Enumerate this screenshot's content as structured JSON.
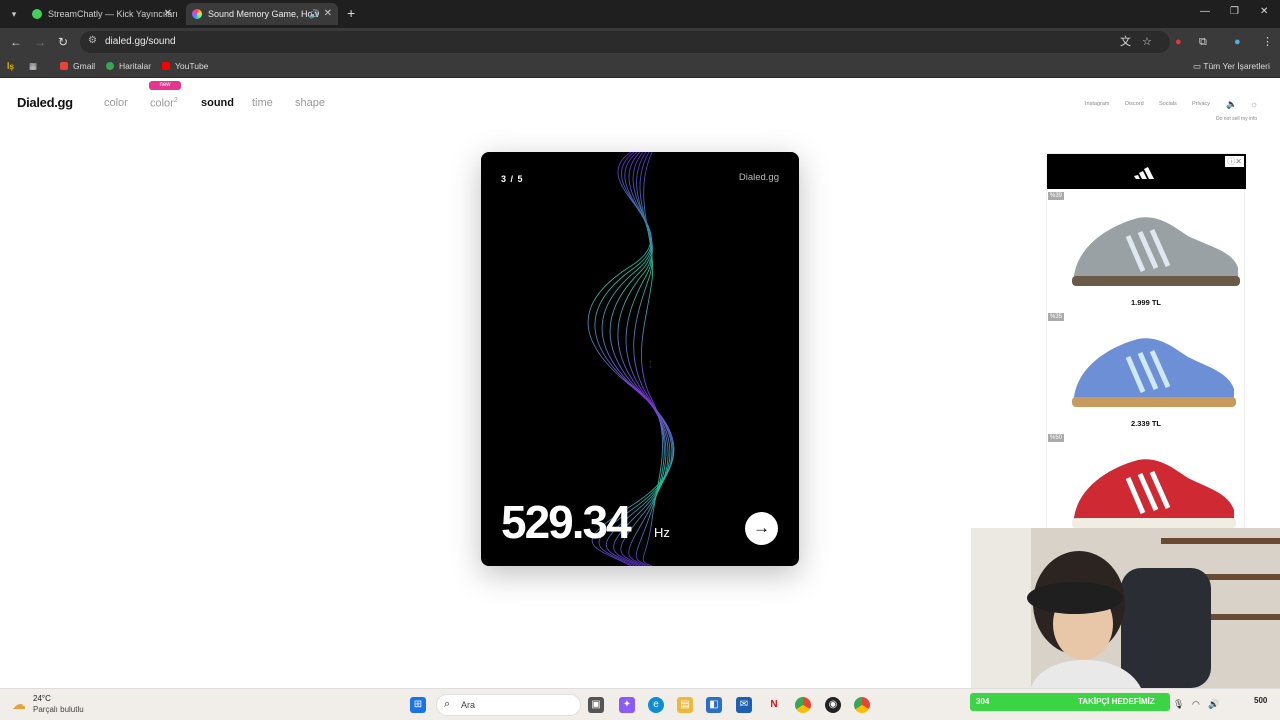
{
  "browser": {
    "tabs": [
      {
        "title": "StreamChatly — Kick Yayıncıları",
        "active": false
      },
      {
        "title": "Sound Memory Game, How",
        "active": true
      }
    ],
    "url": "dialed.gg/sound",
    "bookmarks": [
      "Gmail",
      "Haritalar",
      "YouTube"
    ],
    "all_bookmarks_label": "Tüm Yer İşaretleri"
  },
  "site": {
    "logo": "Dialed.gg",
    "nav": {
      "color": "color",
      "color2": "color",
      "color2_sup": "2",
      "new_badge": "new",
      "sound": "sound",
      "time": "time",
      "shape": "shape"
    },
    "top_links": [
      "Instagram",
      "Discord",
      "Socials",
      "Privacy"
    ],
    "do_not_sell": "Do not sell my info"
  },
  "game": {
    "round": "3 / 5",
    "brand": "Dialed.gg",
    "frequency": "529.34",
    "unit": "Hz"
  },
  "ad": {
    "products": [
      {
        "discount": "%39",
        "price": "1.999 TL",
        "color": "#9aa1a4"
      },
      {
        "discount": "%35",
        "price": "2.339 TL",
        "color": "#6d8fd6"
      },
      {
        "discount": "%50",
        "price": "",
        "color": "#cf2a33"
      }
    ]
  },
  "taskbar": {
    "weather_temp": "24°C",
    "weather_desc": "Parçalı bulutlu",
    "search_placeholder": "Ara",
    "follow_count": "304",
    "follow_label": "TAKİPÇİ HEDEFİMİZ",
    "follow_goal": "500"
  }
}
